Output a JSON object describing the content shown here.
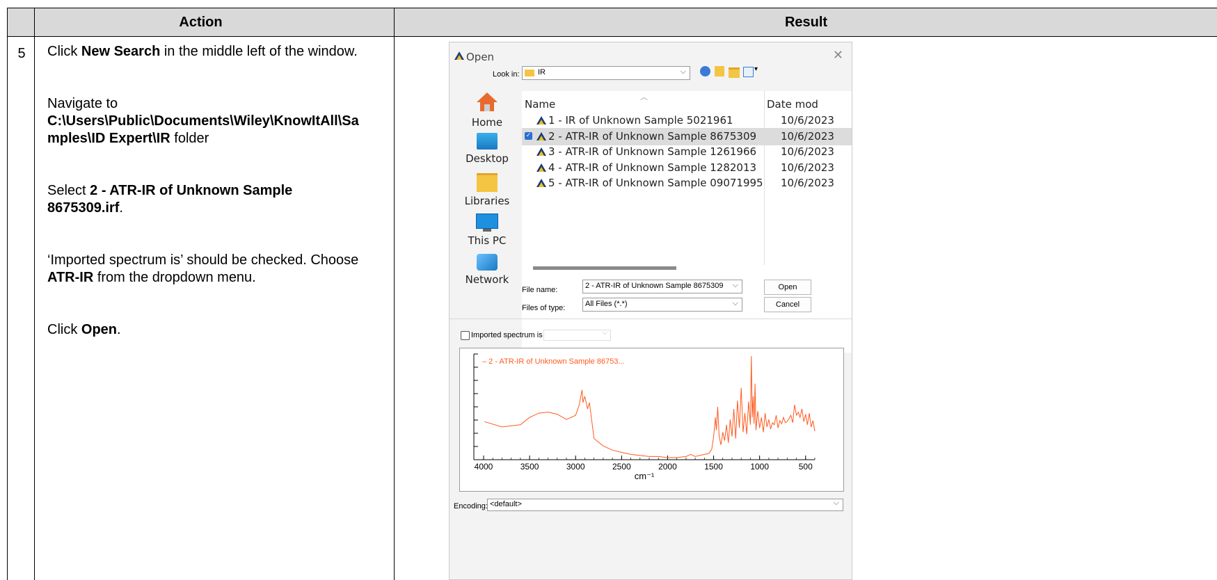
{
  "table": {
    "header_action": "Action",
    "header_result": "Result",
    "step_number": "5"
  },
  "action": {
    "p1_pre": "Click ",
    "p1_bold": "New Search",
    "p1_post": " in the middle left of the window.",
    "p2_pre": "Navigate to",
    "p2_path_line1": "C:\\Users\\Public\\Documents\\Wiley\\KnowItAll\\Sa",
    "p2_path_line2": "mples\\ID Expert\\IR",
    "p2_post": " folder",
    "p3_pre": "Select ",
    "p3_bold_line1": "2 - ATR-IR of Unknown Sample",
    "p3_bold_line2": "8675309.irf",
    "p3_post": ".",
    "p4_line1": "‘Imported spectrum is’ should be checked.  Choose",
    "p4_bold": "ATR-IR",
    "p4_post": " from the dropdown menu.",
    "p5_pre": "Click ",
    "p5_bold": "Open",
    "p5_post": "."
  },
  "dialog": {
    "title": "Open",
    "look_in_label": "Look in:",
    "look_in_value": "IR",
    "nav": [
      {
        "label": "Home",
        "icon": "home-icon"
      },
      {
        "label": "Desktop",
        "icon": "desktop-icon"
      },
      {
        "label": "Libraries",
        "icon": "libraries-icon"
      },
      {
        "label": "This PC",
        "icon": "computer-icon"
      },
      {
        "label": "Network",
        "icon": "network-icon"
      }
    ],
    "columns": {
      "name": "Name",
      "date": "Date mod"
    },
    "files": [
      {
        "name": "1 - IR of Unknown Sample 5021961",
        "date": "10/6/2023"
      },
      {
        "name": "2 - ATR-IR of Unknown Sample 8675309",
        "date": "10/6/2023",
        "selected": true
      },
      {
        "name": "3 - ATR-IR of Unknown Sample 1261966",
        "date": "10/6/2023"
      },
      {
        "name": "4 - ATR-IR of Unknown Sample 1282013",
        "date": "10/6/2023"
      },
      {
        "name": "5 - ATR-IR of Unknown Sample 09071995",
        "date": "10/6/2023"
      }
    ],
    "file_name_label": "File name:",
    "file_name_value": "2 - ATR-IR of Unknown Sample 8675309",
    "files_of_type_label": "Files of type:",
    "files_of_type_value": "All Files (*.*)",
    "open_button": "Open",
    "cancel_button": "Cancel",
    "imported_label": "Imported spectrum is",
    "imported_checked": false,
    "imported_value": "",
    "encoding_label": "Encoding:",
    "encoding_value": "<default>"
  },
  "chart_data": {
    "type": "line",
    "title": "",
    "legend": "2 - ATR-IR of Unknown Sample 86753...",
    "xlabel": "cm⁻¹",
    "ylabel": "",
    "xlim": [
      4000,
      400
    ],
    "ylim": [
      0,
      1
    ],
    "xticks": [
      "4000",
      "3500",
      "3000",
      "2500",
      "2000",
      "1500",
      "1000",
      "500"
    ],
    "line_color": "#ff5a1f",
    "series": [
      {
        "x": [
          3990,
          3800,
          3600,
          3500,
          3400,
          3300,
          3200,
          3100,
          3000,
          2960,
          2930,
          2920,
          2900,
          2870,
          2850,
          2800,
          2700,
          2600,
          2500,
          2400,
          2300,
          2200,
          2100,
          2000,
          1900,
          1800,
          1750,
          1700,
          1650,
          1600,
          1550,
          1520,
          1500,
          1480,
          1470,
          1455,
          1440,
          1420,
          1400,
          1380,
          1360,
          1340,
          1320,
          1300,
          1280,
          1260,
          1240,
          1220,
          1200,
          1180,
          1160,
          1140,
          1120,
          1100,
          1090,
          1080,
          1070,
          1060,
          1050,
          1040,
          1020,
          1000,
          980,
          960,
          940,
          920,
          900,
          880,
          860,
          840,
          820,
          800,
          780,
          760,
          740,
          720,
          700,
          680,
          660,
          640,
          620,
          600,
          580,
          560,
          540,
          520,
          500,
          480,
          460,
          440,
          420,
          400
        ],
        "y": [
          0.36,
          0.31,
          0.33,
          0.4,
          0.44,
          0.45,
          0.43,
          0.38,
          0.42,
          0.52,
          0.66,
          0.54,
          0.6,
          0.48,
          0.54,
          0.2,
          0.13,
          0.09,
          0.07,
          0.05,
          0.04,
          0.03,
          0.03,
          0.02,
          0.02,
          0.03,
          0.05,
          0.03,
          0.04,
          0.05,
          0.06,
          0.1,
          0.22,
          0.4,
          0.28,
          0.5,
          0.22,
          0.14,
          0.26,
          0.18,
          0.33,
          0.16,
          0.38,
          0.22,
          0.48,
          0.2,
          0.56,
          0.3,
          0.68,
          0.26,
          0.44,
          0.24,
          0.55,
          0.33,
          0.98,
          0.4,
          0.6,
          0.34,
          0.72,
          0.28,
          0.46,
          0.3,
          0.4,
          0.26,
          0.44,
          0.31,
          0.38,
          0.29,
          0.35,
          0.33,
          0.42,
          0.3,
          0.37,
          0.34,
          0.4,
          0.35,
          0.36,
          0.39,
          0.42,
          0.35,
          0.52,
          0.42,
          0.45,
          0.4,
          0.48,
          0.36,
          0.43,
          0.33,
          0.44,
          0.31,
          0.37,
          0.27
        ]
      }
    ]
  }
}
